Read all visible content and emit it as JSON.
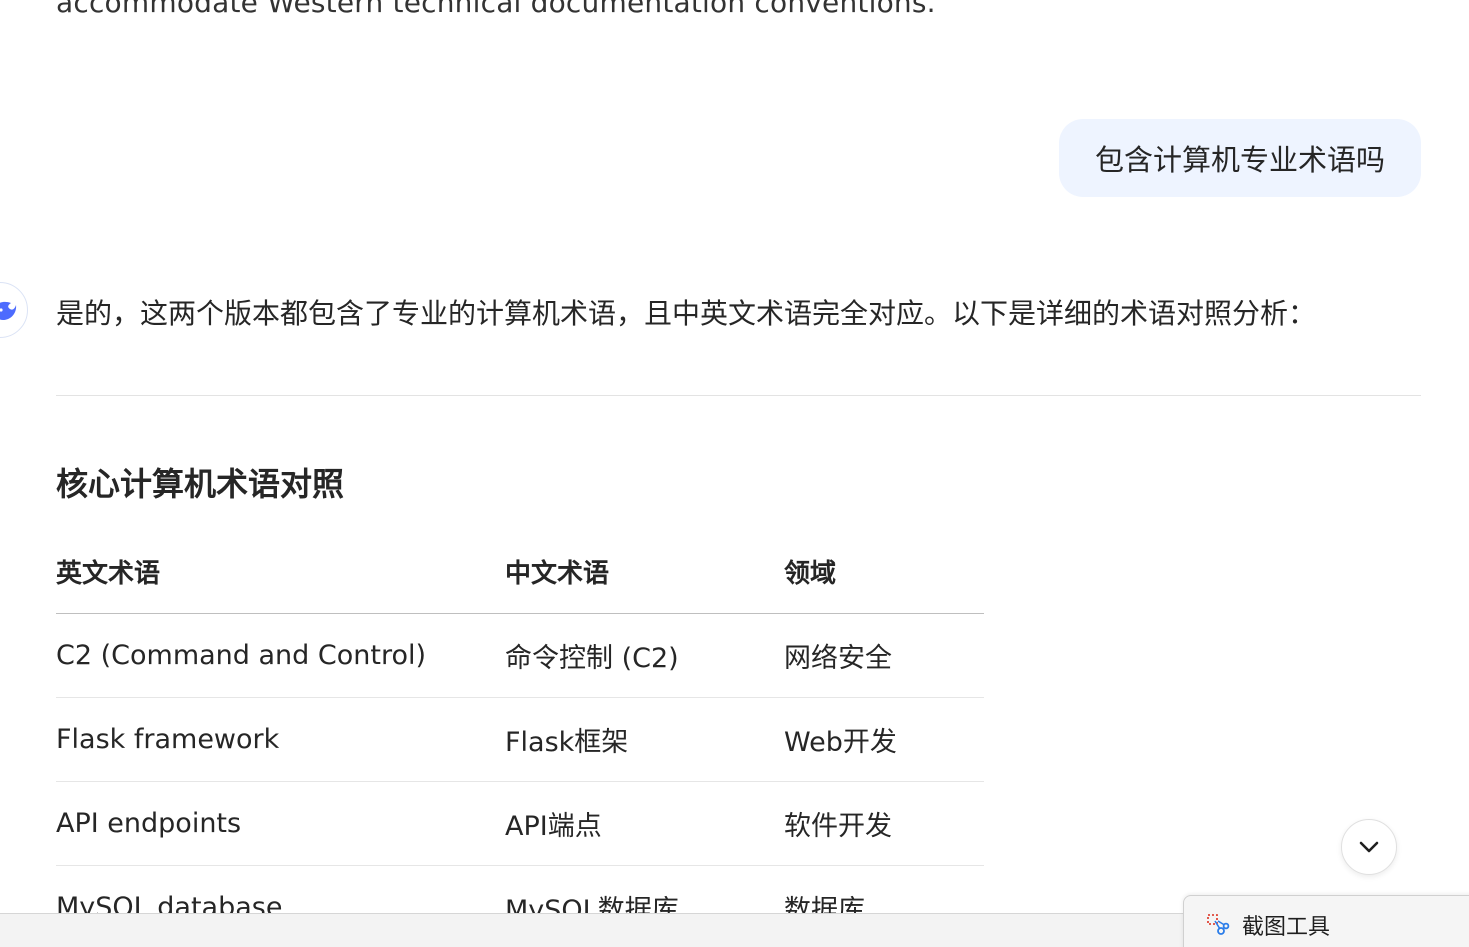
{
  "previous_message": {
    "text": "accommodate Western technical documentation conventions."
  },
  "user_message": {
    "text": "包含计算机专业术语吗"
  },
  "assistant": {
    "avatar_icon": "whale-logo-icon",
    "intro": "是的，这两个版本都包含了专业的计算机术语，且中英文术语完全对应。以下是详细的术语对照分析：",
    "section_title": "核心计算机术语对照",
    "table": {
      "headers": [
        "英文术语",
        "中文术语",
        "领域"
      ],
      "rows": [
        [
          "C2 (Command and Control)",
          "命令控制 (C2)",
          "网络安全"
        ],
        [
          "Flask framework",
          "Flask框架",
          "Web开发"
        ],
        [
          "API endpoints",
          "API端点",
          "软件开发"
        ],
        [
          "MySQL database",
          "MySQL数据库",
          "数据库"
        ]
      ]
    }
  },
  "scroll_button": {
    "icon": "chevron-down-icon"
  },
  "taskbar": {
    "snipping_tool_label": "截图工具",
    "snipping_tool_icon": "scissors-icon"
  },
  "colors": {
    "user_bubble": "#eef4ff",
    "accent": "#4d6bfe",
    "text": "#262626"
  }
}
